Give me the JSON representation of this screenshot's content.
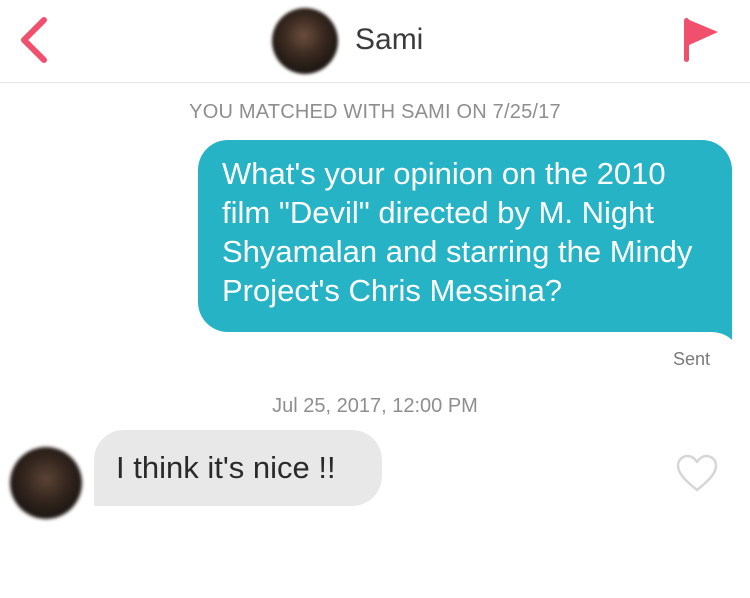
{
  "header": {
    "contact_name": "Sami",
    "back_icon": "chevron-left-icon",
    "report_icon": "flag-icon",
    "accent_color": "#f0506e"
  },
  "conversation": {
    "match_notice": "YOU MATCHED WITH SAMI ON 7/25/17",
    "outgoing_message": {
      "text": "What's your opinion on the 2010 film \"Devil\" directed by M. Night Shyamalan and starring the Mindy Project's Chris Messina?",
      "status": "Sent",
      "bubble_color": "#27b3c6"
    },
    "timestamp": "Jul 25, 2017, 12:00 PM",
    "incoming_message": {
      "text": "I think it's nice !!",
      "bubble_color": "#e8e8e8",
      "like_icon": "heart-outline-icon"
    }
  }
}
